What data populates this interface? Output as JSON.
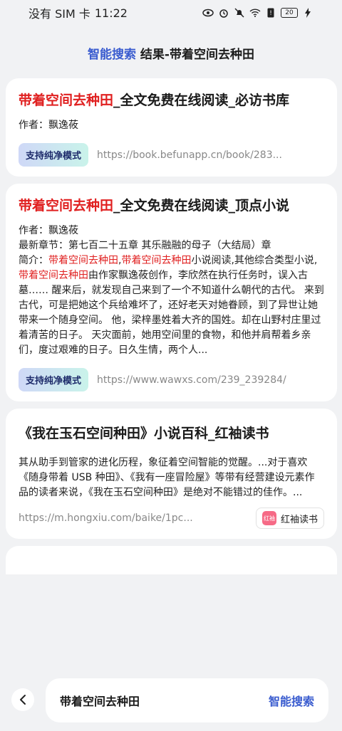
{
  "status_bar": {
    "carrier": "没有 SIM 卡",
    "time": "11:22",
    "battery": "20"
  },
  "header": {
    "brand": "智能搜索",
    "title": "结果-带着空间去种田"
  },
  "results": [
    {
      "title_hl": "带着空间去种田",
      "title_rest": "_全文免费在线阅读_必访书库",
      "author": "作者：飘逸莜",
      "badge": "支持纯净模式",
      "url": "https://book.befunapp.cn/book/283..."
    },
    {
      "title_hl": "带着空间去种田",
      "title_rest": "_全文免费在线阅读_顶点小说",
      "author": "作者：飘逸莜",
      "latest": "最新章节：第七百二十五章 其乐融融的母子（大结局）章",
      "intro_prefix": "简介：",
      "intro_hl1": "带着空间去种田",
      "intro_comma": ",",
      "intro_hl2": "带着空间去种田",
      "intro_mid": "小说阅读,其他综合类型小说,",
      "intro_hl3": "带着空间去种田",
      "intro_rest": "由作家飘逸莜创作，李欣然在执行任务时，误入古墓…… 醒来后，就发现自己来到了一个不知道什么朝代的古代。 来到古代，可是把她这个兵给难坏了，还好老天对她眷顾，到了异世让她带来一个随身空间。 他，梁梓墨姓着大齐的国姓。却在山野村庄里过着清苦的日子。 天灾面前，她用空间里的食物，和他并肩帮着乡亲们，度过艰难的日子。日久生情，两个人...",
      "badge": "支持纯净模式",
      "url": "https://www.wawxs.com/239_239284/"
    },
    {
      "title": "《我在玉石空间种田》小说百科_红袖读书",
      "snippet": "其从助手到管家的进化历程，象征着空间智能的觉醒。...对于喜欢《随身带着 USB 种田》、《我有一座冒险屋》等带有经营建设元素作品的读者来说，《我在玉石空间种田》是绝对不能错过的佳作。...",
      "url": "https://m.hongxiu.com/baike/1pc...",
      "site_logo": "红袖",
      "site_name": "红袖读书"
    }
  ],
  "bottom": {
    "query": "带着空间去种田",
    "action": "智能搜索"
  }
}
